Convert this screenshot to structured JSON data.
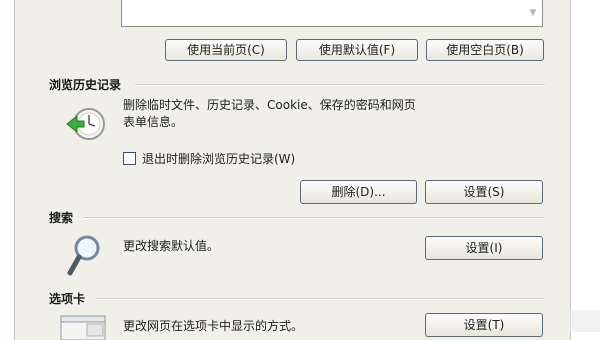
{
  "home_page": {
    "buttons": {
      "use_current": "使用当前页(C)",
      "use_default": "使用默认值(F)",
      "use_blank": "使用空白页(B)"
    }
  },
  "browsing_history": {
    "title": "浏览历史记录",
    "description_line1": "删除临时文件、历史记录、Cookie、保存的密码和网页",
    "description_line2": "表单信息。",
    "checkbox_label": "退出时删除浏览历史记录(W)",
    "checkbox_checked": false,
    "delete_button": "删除(D)...",
    "settings_button": "设置(S)",
    "icon": "history-clock-icon"
  },
  "search": {
    "title": "搜索",
    "description": "更改搜索默认值。",
    "settings_button": "设置(I)",
    "icon": "magnifier-icon"
  },
  "tabs": {
    "title": "选项卡",
    "description": "更改网页在选项卡中显示的方式。",
    "settings_button": "设置(T)",
    "icon": "tabs-window-icon"
  }
}
